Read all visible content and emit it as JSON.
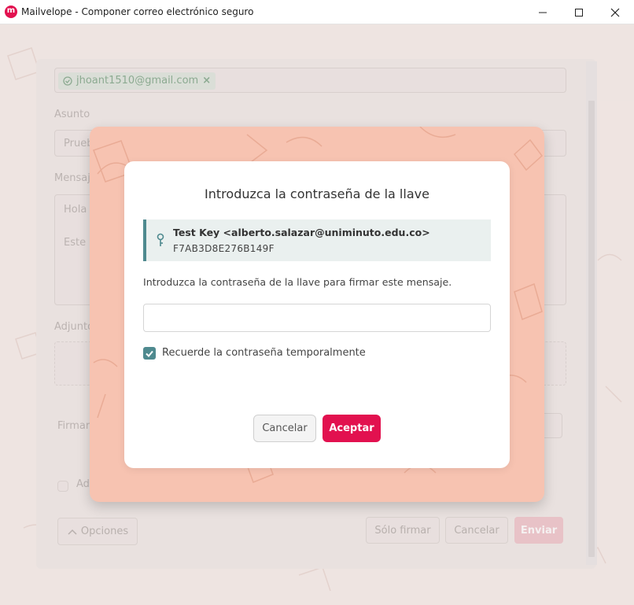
{
  "window": {
    "title": "Mailvelope - Componer correo electrónico seguro"
  },
  "background_form": {
    "recipient": "jhoant1510@gmail.com",
    "subject_label": "Asunto",
    "subject_value": "Prueb",
    "message_label": "Mensaj",
    "message_line1": "Hola",
    "message_line2": "Este",
    "attachments_label": "Adjunto",
    "sign_label": "Firmar",
    "ad_label": "Ad",
    "options_button": "Opciones",
    "only_sign_button": "Sólo firmar",
    "cancel_button": "Cancelar",
    "send_button": "Enviar"
  },
  "dialog": {
    "title": "Introduzca la contraseña de la llave",
    "key_name": "Test Key <alberto.salazar@uniminuto.edu.co>",
    "key_id": "F7AB3D8E276B149F",
    "instruction": "Introduzca la contraseña de la llave para firmar este mensaje.",
    "password_value": "",
    "remember_label": "Recuerde la contraseña temporalmente",
    "remember_checked": true,
    "cancel_label": "Cancelar",
    "accept_label": "Aceptar"
  },
  "colors": {
    "brand": "#e2114f",
    "accent": "#4f8a8f",
    "salmon": "#f7c3b1"
  }
}
